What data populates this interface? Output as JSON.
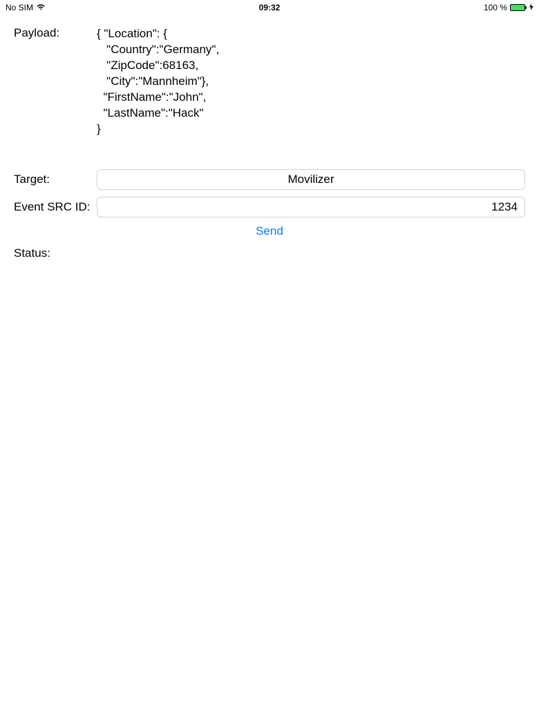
{
  "status_bar": {
    "carrier": "No SIM",
    "time": "09:32",
    "battery_percent": "100 %"
  },
  "payload": {
    "label": "Payload:",
    "value": "{ \"Location\": {\n   \"Country\":\"Germany\",\n   \"ZipCode\":68163,\n   \"City\":\"Mannheim\"},\n  \"FirstName\":\"John\",\n  \"LastName\":\"Hack\"\n}"
  },
  "target": {
    "label": "Target:",
    "value": "Movilizer"
  },
  "event_src_id": {
    "label": "Event SRC ID:",
    "value": "1234"
  },
  "send_button": "Send",
  "status": {
    "label": "Status:",
    "value": ""
  }
}
